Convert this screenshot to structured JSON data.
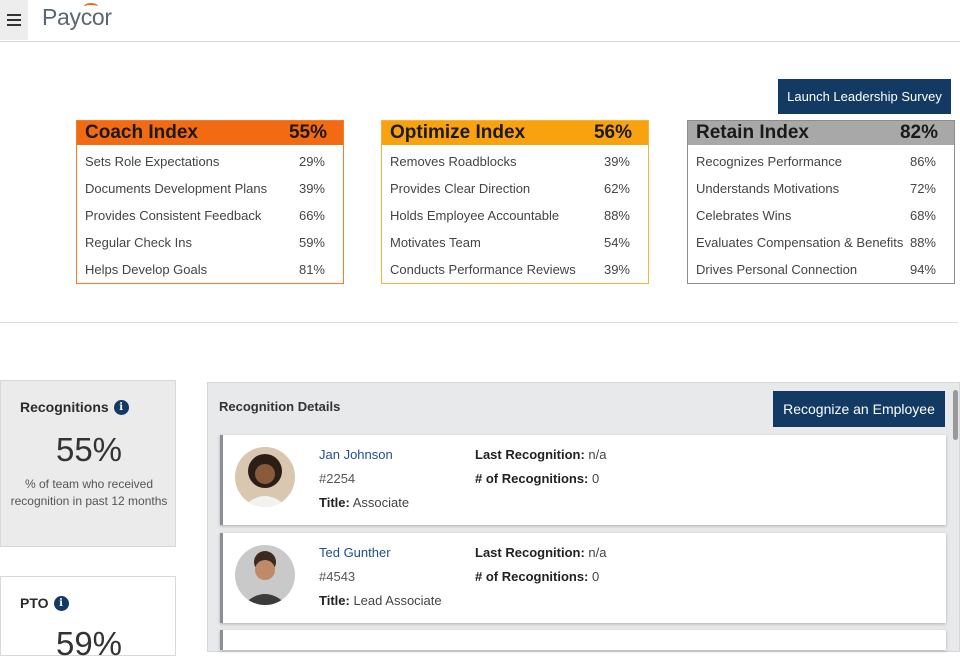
{
  "header": {
    "logo": "Paycor"
  },
  "survey_button": "Launch Leadership Survey",
  "indexes": [
    {
      "title": "Coach Index",
      "score": "55%",
      "color": "#f26a11",
      "items": [
        {
          "label": "Sets Role Expectations",
          "value": "29%"
        },
        {
          "label": "Documents Development Plans",
          "value": "39%"
        },
        {
          "label": "Provides Consistent Feedback",
          "value": "66%"
        },
        {
          "label": "Regular Check Ins",
          "value": "59%"
        },
        {
          "label": "Helps Develop Goals",
          "value": "81%"
        }
      ]
    },
    {
      "title": "Optimize Index",
      "score": "56%",
      "color": "#f9a20f",
      "items": [
        {
          "label": "Removes Roadblocks",
          "value": "39%"
        },
        {
          "label": "Provides Clear Direction",
          "value": "62%"
        },
        {
          "label": "Holds Employee Accountable",
          "value": "88%"
        },
        {
          "label": "Motivates Team",
          "value": "54%"
        },
        {
          "label": "Conducts Performance Reviews",
          "value": "39%"
        }
      ]
    },
    {
      "title": "Retain Index",
      "score": "82%",
      "color": "#a8a8a8",
      "items": [
        {
          "label": "Recognizes Performance",
          "value": "86%"
        },
        {
          "label": "Understands Motivations",
          "value": "72%"
        },
        {
          "label": "Celebrates Wins",
          "value": "68%"
        },
        {
          "label": "Evaluates Compensation & Benefits",
          "value": "88%"
        },
        {
          "label": "Drives Personal Connection",
          "value": "94%"
        }
      ]
    }
  ],
  "recognitions": {
    "title": "Recognitions",
    "value": "55%",
    "description": "% of team who received recognition in past 12 months"
  },
  "pto": {
    "title": "PTO",
    "value": "59%"
  },
  "details": {
    "title": "Recognition Details",
    "button": "Recognize an Employee",
    "last_label": "Last Recognition:",
    "count_label": "# of Recognitions:",
    "title_label": "Title:",
    "employees": [
      {
        "name": "Jan Johnson",
        "id": "#2254",
        "title": "Associate",
        "last": "n/a",
        "count": "0"
      },
      {
        "name": "Ted Gunther",
        "id": "#4543",
        "title": "Lead Associate",
        "last": "n/a",
        "count": "0"
      }
    ]
  },
  "colors": {
    "brand_navy": "#123a63",
    "coach": "#f26a11",
    "optimize": "#f9a20f",
    "retain": "#a8a8a8"
  }
}
